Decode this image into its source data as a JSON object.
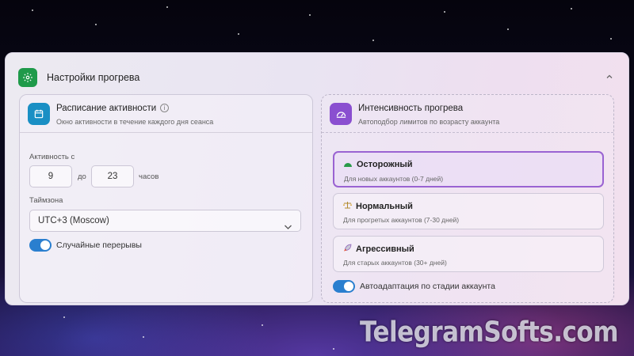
{
  "watermark": "TelegramSofts.com",
  "section": {
    "title": "Настройки прогрева",
    "icon": "gear-icon",
    "accent": "#1f9a4a"
  },
  "schedule": {
    "title": "Расписание активности",
    "subtitle": "Окно активности в течение каждого дня сеанса",
    "icon": "calendar-icon",
    "accent": "#1a8fc4",
    "activity_label": "Активность с",
    "from_value": "9",
    "to_label": "до",
    "to_value": "23",
    "hours_label": "часов",
    "timezone_label": "Таймзона",
    "timezone_value": "UTC+3 (Moscow)",
    "random_breaks_label": "Случайные перерывы",
    "random_breaks_enabled": true
  },
  "intensity": {
    "title": "Интенсивность прогрева",
    "subtitle": "Автоподбор лимитов по возрасту аккаунта",
    "icon": "speedometer-icon",
    "accent": "#8a4fd0",
    "options": [
      {
        "title": "Осторожный",
        "subtitle": "Для новых аккаунтов (0-7 дней)",
        "icon": "green-half-circle-icon",
        "selected": true
      },
      {
        "title": "Нормальный",
        "subtitle": "Для прогретых аккаунтов (7-30 дней)",
        "icon": "balance-scale-icon",
        "selected": false
      },
      {
        "title": "Агрессивный",
        "subtitle": "Для старых аккаунтов (30+ дней)",
        "icon": "rocket-icon",
        "selected": false
      }
    ],
    "auto_adapt_label": "Автоадаптация по стадии аккаунта",
    "auto_adapt_enabled": true
  }
}
